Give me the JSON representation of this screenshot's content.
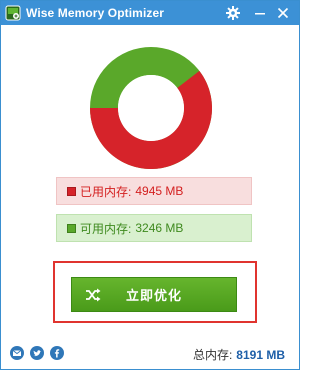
{
  "window": {
    "title": "Wise Memory Optimizer"
  },
  "memory": {
    "used_label": "已用内存:",
    "used_value": "4945 MB",
    "free_label": "可用内存:",
    "free_value": "3246 MB",
    "total_label": "总内存:",
    "total_value": "8191 MB",
    "used_fraction": 0.604
  },
  "actions": {
    "optimize_label": "立即优化"
  },
  "colors": {
    "titlebar": "#3c91d6",
    "used": "#d6232a",
    "free": "#5aa82a",
    "button": "#5aaa22",
    "highlight": "#e0342f"
  },
  "icons": {
    "app": "memory-chip-icon",
    "settings": "gear-icon",
    "minimize": "minimize-icon",
    "close": "close-icon",
    "optimize": "shuffle-icon",
    "mail": "mail-icon",
    "twitter": "twitter-icon",
    "facebook": "facebook-icon"
  }
}
